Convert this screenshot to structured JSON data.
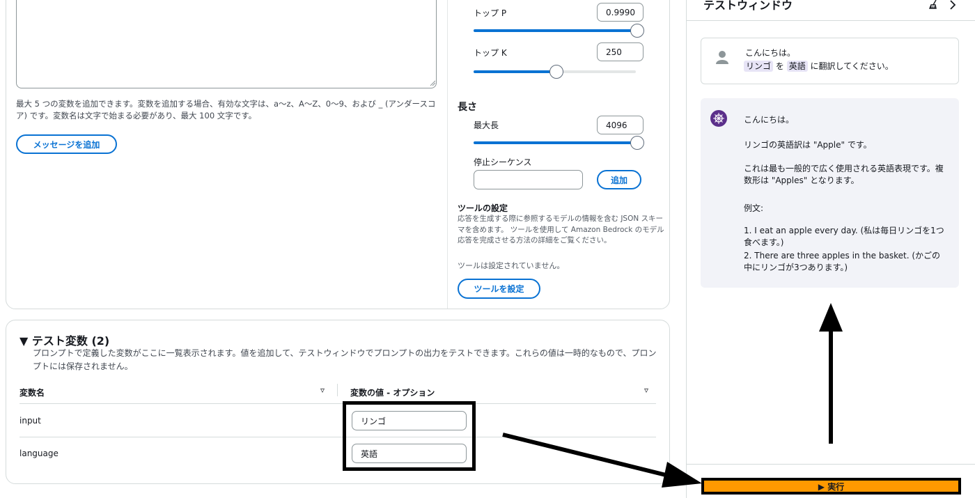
{
  "prompt_editor": {
    "variable_help": "最大 5 つの変数を追加できます。変数を追加する場合、有効な文字は、a～z、A～Z、0～9、および _ (アンダースコア) です。変数名は文字で始まる必要があり、最大 100 文字です。",
    "add_message_label": "メッセージを追加"
  },
  "parameters": {
    "top_p": {
      "label": "トップ P",
      "value": "0.9990",
      "level": 1.0
    },
    "top_k": {
      "label": "トップ K",
      "value": "250",
      "level": 0.5
    },
    "length_title": "長さ",
    "max_length": {
      "label": "最大長",
      "value": "4096",
      "level": 1.0
    },
    "stop_sequence": {
      "label": "停止シーケンス",
      "value": "",
      "add_label": "追加"
    }
  },
  "tools": {
    "title": "ツールの設定",
    "description": "応答を生成する際に参照するモデルの情報を含む JSON スキーマを含めます。 ツールを使用して Amazon Bedrock のモデル応答を完成させる方法の詳細をご覧ください。",
    "none_text": "ツールは設定されていません。",
    "configure_label": "ツールを設定"
  },
  "test_variables": {
    "toggle_glyph": "▼",
    "title": "テスト変数 (2)",
    "description": "プロンプトで定義した変数がここに一覧表示されます。値を追加して、テストウィンドウでプロンプトの出力をテストできます。これらの値は一時的なもので、プロンプトには保存されません。",
    "columns": [
      "変数名",
      "変数の値 - オプション"
    ],
    "sort_glyph": "▿",
    "rows": [
      {
        "name": "input",
        "value": "リンゴ"
      },
      {
        "name": "language",
        "value": "英語"
      }
    ]
  },
  "test_window": {
    "title": "テストウィンドウ",
    "icons": [
      "broom-icon",
      "chevron-right-icon"
    ],
    "user_message": {
      "line1": "こんにちは。",
      "word1": "リンゴ",
      "particle1": "を",
      "word2": "英語",
      "tail": "に翻訳してください。"
    },
    "ai_message": {
      "greeting": "こんにちは。",
      "p1": "リンゴの英語訳は \"Apple\" です。",
      "p2": "これは最も一般的で広く使用される英語表現です。複数形は \"Apples\" となります。",
      "p3": "例文:",
      "ex1": "1. I eat an apple every day. (私は毎日リンゴを1つ食べます。)",
      "ex2": "2. There are three apples in the basket. (かごの中にリンゴが3つあります。)"
    },
    "run_label": "▶ 実行"
  }
}
